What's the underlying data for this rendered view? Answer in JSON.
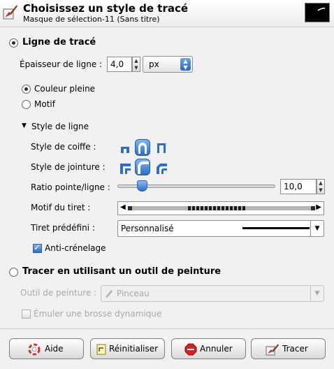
{
  "header": {
    "title": "Choisissez un style de tracé",
    "subtitle": "Masque de sélection-11 (Sans titre)"
  },
  "stroke_line": {
    "label": "Ligne de tracé",
    "selected": true,
    "width_label": "Épaisseur de ligne :",
    "width_value": "4,0",
    "unit": "px",
    "fill_options": [
      {
        "label": "Couleur pleine",
        "selected": true
      },
      {
        "label": "Motif",
        "selected": false
      }
    ],
    "line_style": {
      "expander_label": "Style de ligne",
      "expanded": true,
      "cap_label": "Style de coiffe :",
      "cap_selected": "round",
      "join_label": "Style de jointure :",
      "join_selected": "round",
      "miter_label": "Ratio pointe/ligne :",
      "miter_value": "10,0",
      "miter_fraction": 0.1,
      "dash_label": "Motif du tiret :",
      "dash_preset_label": "Tiret prédéfini :",
      "dash_preset_value": "Personnalisé"
    },
    "antialias_label": "Anti-crénelage",
    "antialias_checked": true
  },
  "paint_tool": {
    "label": "Tracer en utilisant un outil de peinture",
    "selected": false,
    "tool_label": "Outil de peinture :",
    "tool_value": "Pinceau",
    "emulate_label": "Émuler une brosse dynamique",
    "emulate_checked": false
  },
  "buttons": {
    "help": "Aide",
    "reset": "Réinitialiser",
    "cancel": "Annuler",
    "stroke": "Tracer"
  },
  "icons": {
    "header": "stroke-tool-icon",
    "thumbnail": "selection-preview-icon"
  }
}
